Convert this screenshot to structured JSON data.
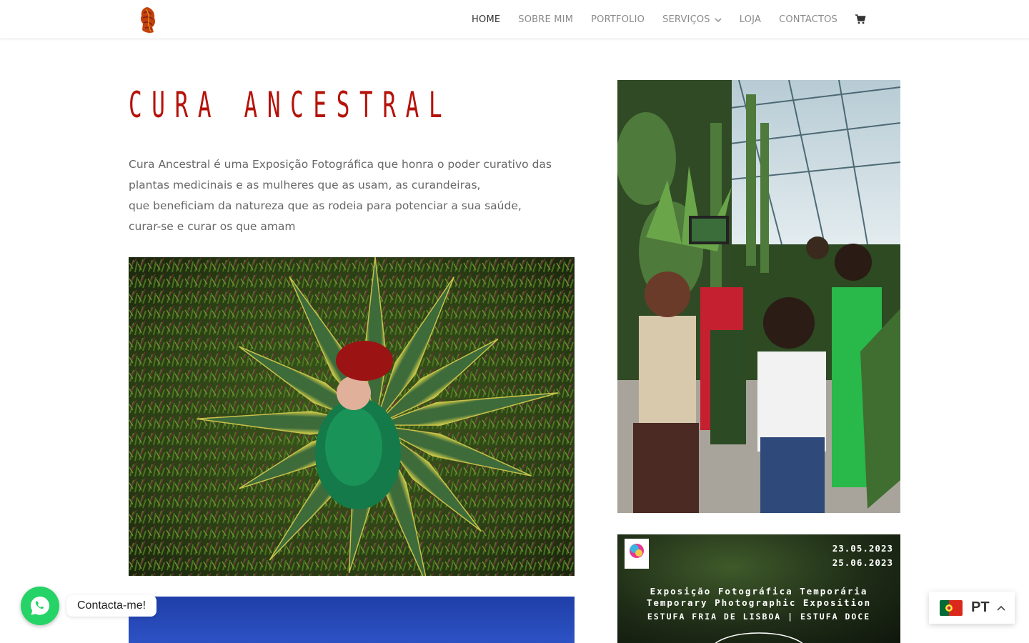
{
  "header": {
    "nav": [
      {
        "label": "HOME",
        "active": true
      },
      {
        "label": "SOBRE MIM"
      },
      {
        "label": "PORTFOLIO"
      },
      {
        "label": "SERVIÇOS",
        "has_dropdown": true
      },
      {
        "label": "LOJA"
      },
      {
        "label": "CONTACTOS"
      }
    ],
    "cart_icon": "shopping-cart-icon"
  },
  "main": {
    "title": "CURA ANCESTRAL",
    "description_lines": [
      "Cura Ancestral é uma Exposição Fotográfica que honra o poder curativo das",
      "plantas medicinais e as mulheres que as usam, as curandeiras,",
      "que beneficiam da natureza que as rodeia para potenciar a sua saúde,",
      "curar-se e curar os que amam"
    ]
  },
  "poster": {
    "date_start": "23.05.2023",
    "date_end": "25.06.2023",
    "line1": "Exposição Fotográfica Temporária",
    "line2": "Temporary Photographic Exposition",
    "line3": "ESTUFA FRIA DE LISBOA | ESTUFA DOCE"
  },
  "whatsapp": {
    "label": "Contacta-me!",
    "icon": "whatsapp-icon"
  },
  "language": {
    "code": "PT",
    "flag": "portugal-flag-icon"
  },
  "colors": {
    "title_red": "#b5120a",
    "whatsapp_green": "#25d366"
  }
}
